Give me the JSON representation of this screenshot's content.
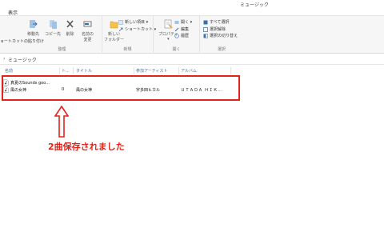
{
  "window": {
    "title": "ミュージック"
  },
  "menubar": {
    "view_label": "表示"
  },
  "ribbon": {
    "left_cut_label": "ョートカットの貼り付け",
    "groups": [
      {
        "name": "整理",
        "buttons": [
          "移動先",
          "コピー先",
          "削除",
          "名前の\n変更"
        ]
      },
      {
        "name": "新規",
        "buttons": [
          "新しい\nフォルダー"
        ],
        "items": [
          "新しい項目 ▾",
          "ショートカット ▾"
        ]
      },
      {
        "name": "開く",
        "buttons": [
          "プロパティ\n▾"
        ],
        "items": [
          "開く ▾",
          "編集",
          "履歴"
        ]
      },
      {
        "name": "選択",
        "items": [
          "すべて選択",
          "選択解除",
          "選択の切り替え"
        ]
      }
    ]
  },
  "address": {
    "crumb": "ミュージック"
  },
  "columns": {
    "name": "名前",
    "track": "ト...",
    "title": "タイトル",
    "artist": "参加アーティスト",
    "album": "アルバム"
  },
  "files": [
    {
      "name": "真夏のSounds goo...",
      "track": "",
      "title": "",
      "artist": "",
      "album": ""
    },
    {
      "name": "風の女神",
      "track": "0",
      "title": "風の女神",
      "artist": "宇多田ヒカル",
      "album": "ＵＴＡＤＡ ＨＩＫ..."
    }
  ],
  "annotation": {
    "text": "2曲保存されました",
    "color": "#e2231a"
  },
  "icons": {
    "file": "music-file-icon",
    "arrow": "up-arrow-icon"
  }
}
